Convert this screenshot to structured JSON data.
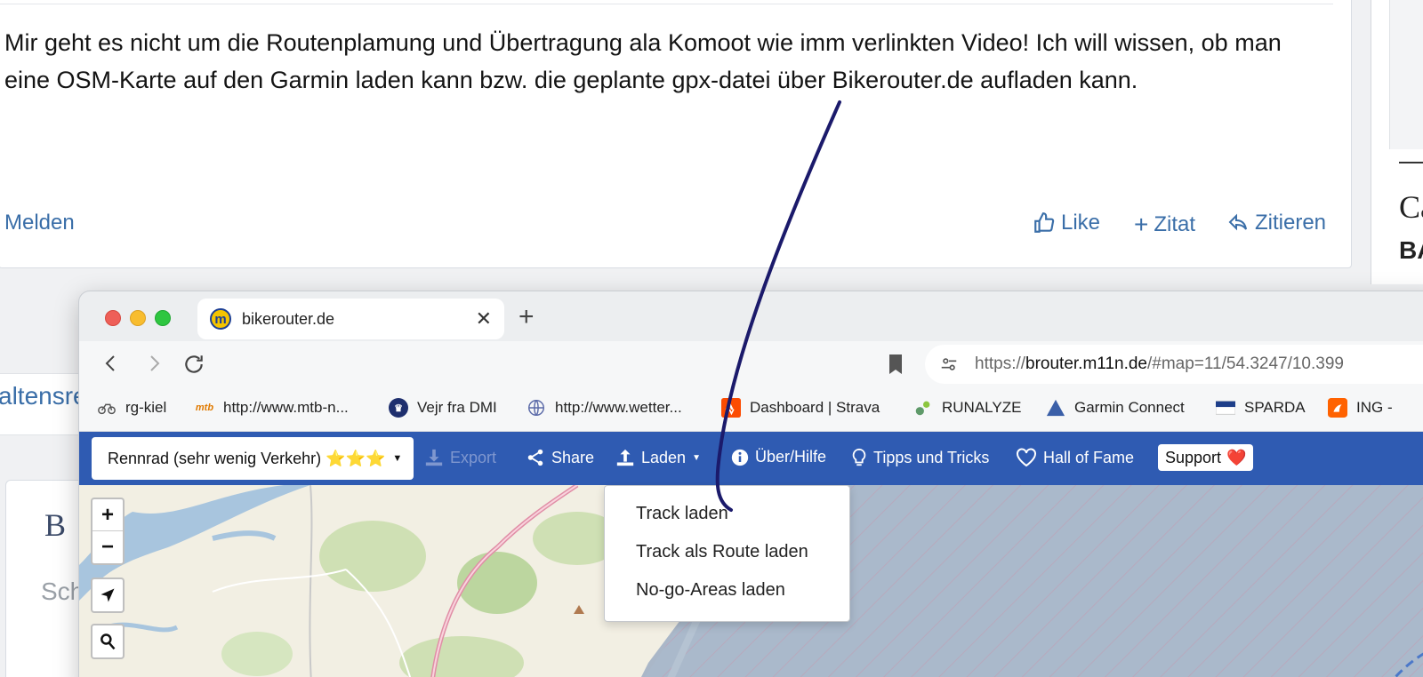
{
  "forum": {
    "post_text": "Mir geht es nicht um die Routenplamung und Übertragung ala Komoot wie imm verlinkten Video! Ich will wissen, ob man eine OSM-Karte auf den Garmin laden kann bzw. die geplante gpx-datei über Bikerouter.de aufladen kann.",
    "report_label": "Melden",
    "like_label": "Like",
    "quote_add_label": "Zitat",
    "quote_label": "Zitieren",
    "sidebar_heading_1": "Ca",
    "sidebar_heading_2": "BA",
    "partial_link": "altensre",
    "card_letter": "B",
    "card_text": "Sch"
  },
  "browser": {
    "tab_title": "bikerouter.de",
    "tab_favicon": "m",
    "new_tab_label": "+",
    "url_prefix": "https://",
    "url_host": "brouter.m11n.de",
    "url_rest": "/#map=11/54.3247/10.399",
    "bookmarks": [
      {
        "label": "rg-kiel",
        "icon": "bicycle-icon"
      },
      {
        "label": "http://www.mtb-n...",
        "icon": "mtb-news-icon",
        "icon_text": "mtb"
      },
      {
        "label": "Vejr fra DMI",
        "icon": "crown-icon"
      },
      {
        "label": "http://www.wetter...",
        "icon": "globe-icon"
      },
      {
        "label": "Dashboard | Strava",
        "icon": "strava-icon"
      },
      {
        "label": "RUNALYZE",
        "icon": "runalyze-icon"
      },
      {
        "label": "Garmin Connect",
        "icon": "garmin-icon"
      },
      {
        "label": "SPARDA",
        "icon": "sparda-icon"
      },
      {
        "label": "ING -",
        "icon": "ing-lion-icon"
      }
    ]
  },
  "app": {
    "profile_label": "Rennrad (sehr wenig Verkehr) ⭐⭐⭐",
    "nav": {
      "export": "Export",
      "share": "Share",
      "load": "Laden",
      "help": "Über/Hilfe",
      "tips": "Tipps und Tricks",
      "hall": "Hall of Fame",
      "support": "Support",
      "support_heart": "❤️"
    },
    "zoom_in": "+",
    "zoom_out": "−",
    "load_menu": [
      "Track laden",
      "Track als Route laden",
      "No-go-Areas laden"
    ]
  },
  "colors": {
    "navbar": "#2f5bb2",
    "link": "#3a6ea8",
    "annotation": "#1b1a6b"
  }
}
